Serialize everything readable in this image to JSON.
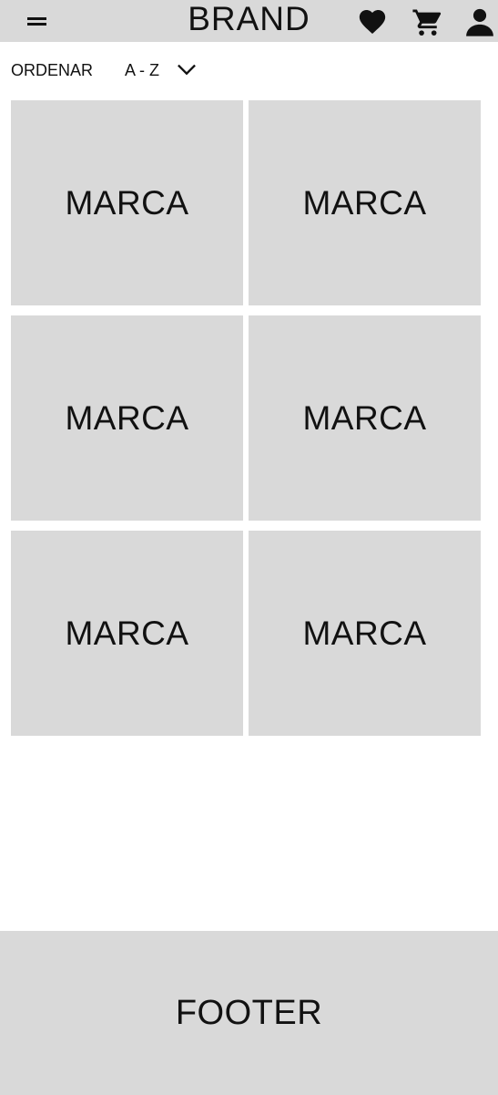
{
  "header": {
    "brand": "BRAND",
    "icons": [
      "menu-icon",
      "heart-icon",
      "cart-icon",
      "user-icon"
    ]
  },
  "sort": {
    "label": "ORDENAR",
    "value": "A - Z",
    "icon": "chevron-down-icon"
  },
  "brands": [
    {
      "label": "MARCA"
    },
    {
      "label": "MARCA"
    },
    {
      "label": "MARCA"
    },
    {
      "label": "MARCA"
    },
    {
      "label": "MARCA"
    },
    {
      "label": "MARCA"
    }
  ],
  "footer": {
    "label": "FOOTER"
  },
  "colors": {
    "placeholder_bg": "#d9d9d9",
    "page_bg": "#ffffff",
    "text": "#111111"
  }
}
